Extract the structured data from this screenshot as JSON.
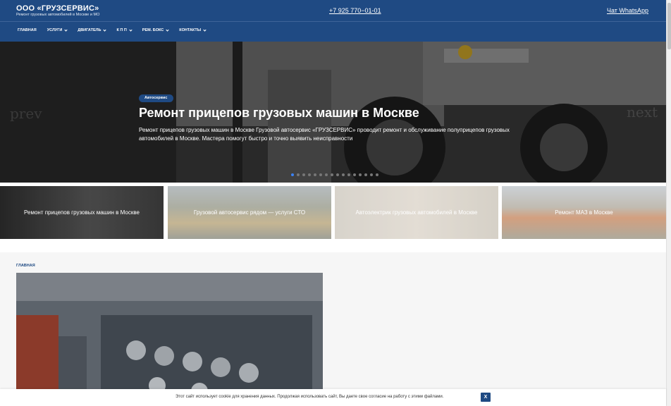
{
  "header": {
    "brand_title": "ООО «ГРУЗСЕРВИС»",
    "brand_subtitle": "Ремонт грузовых автомобилей в Москве и МО",
    "phone": "+7 925 770−01-01",
    "whatsapp": "Чат WhatsApp",
    "nav": [
      {
        "label": "Главная",
        "has_dropdown": false
      },
      {
        "label": "Услуги",
        "has_dropdown": true
      },
      {
        "label": "Двигатель",
        "has_dropdown": true
      },
      {
        "label": "К П П",
        "has_dropdown": true
      },
      {
        "label": "Рем. бокс",
        "has_dropdown": true
      },
      {
        "label": "Контакты",
        "has_dropdown": true
      }
    ]
  },
  "hero": {
    "prev_label": "prev",
    "next_label": "next",
    "badge": "Автосервис",
    "title": "Ремонт прицепов грузовых машин в Москве",
    "description": "Ремонт прицепов грузовых машин в Москве Грузовой автосервис «ГРУЗСЕРВИС» проводит ремонт и обслуживание полуприцепов грузовых автомобилей в Москве. Мастера помогут быстро и точно выявить неисправности",
    "dots_count": 16,
    "active_dot": 0
  },
  "cards": [
    {
      "label": "Ремонт прицепов грузовых машин в Москве"
    },
    {
      "label": "Грузовой автосервис рядом — услуги СТО"
    },
    {
      "label": "Автоэлектрик грузовых автомобилей в Москве"
    },
    {
      "label": "Ремонт МАЗ в Москве"
    }
  ],
  "main": {
    "breadcrumb": "Главная"
  },
  "cookie": {
    "text": "Этот сайт использует cookie для хранения данных. Продолжая использовать сайт, Вы даете свое согласие на работу с этими файлами.",
    "button": "X"
  },
  "colors": {
    "brand": "#1f4a83",
    "active_dot": "#3b82f6"
  }
}
